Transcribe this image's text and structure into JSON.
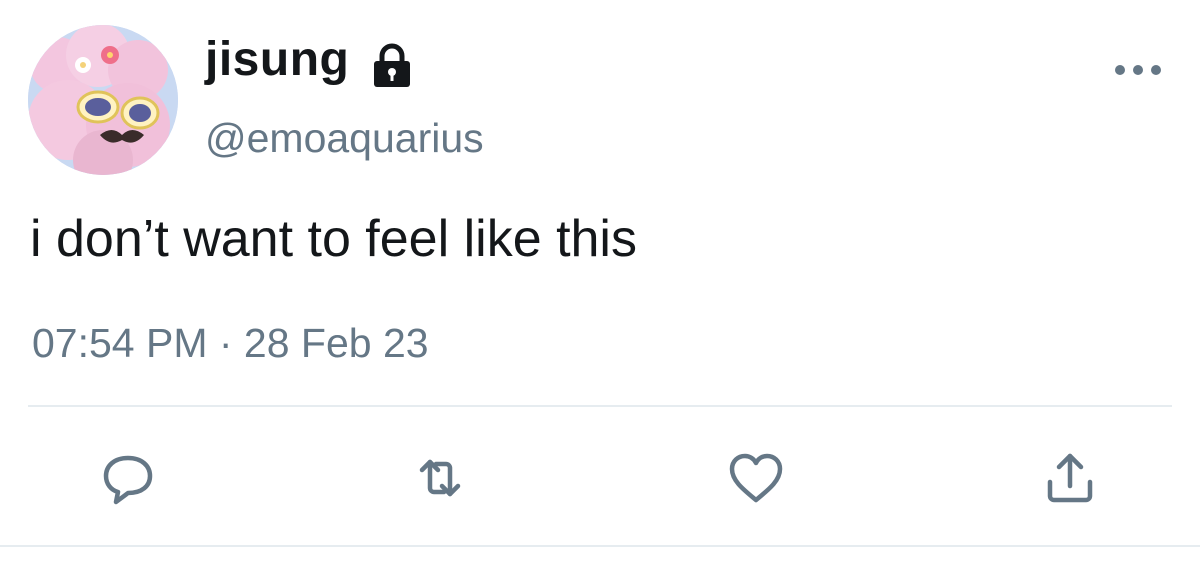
{
  "user": {
    "display_name": "jisung",
    "handle": "@emoaquarius",
    "protected": true,
    "avatar_icon": "avatar-image"
  },
  "tweet": {
    "text": "i don’t want to feel like this",
    "timestamp": "07:54 PM · 28 Feb 23"
  },
  "icons": {
    "lock": "lock-icon",
    "more": "more-icon",
    "reply": "reply-icon",
    "retweet": "retweet-icon",
    "like": "like-icon",
    "share": "share-icon"
  },
  "colors": {
    "primary_text": "#14171a",
    "secondary_text": "#657786",
    "divider": "#e6ecf0"
  }
}
